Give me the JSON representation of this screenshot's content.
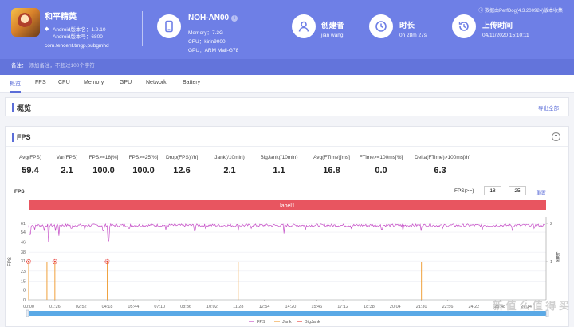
{
  "header": {
    "app_name": "和平精英",
    "version_name": "Android版本名：1.9.10",
    "version_code": "Android版本号：6800",
    "package": "com.tencent.tmgp.pubgmhd",
    "device_name": "NOH-AN00",
    "memory": "Memory：7.3G",
    "cpu": "CPU：kirin9000",
    "gpu": "GPU：ARM Mali-G78",
    "creator_label": "创建者",
    "creator": "jian wang",
    "duration_label": "时长",
    "duration": "0h 28m 27s",
    "upload_label": "上传时间",
    "upload_time": "04/11/2020 15:10:11",
    "version_note": "数据由PerfDog(4.3.200924)版本收集"
  },
  "note": {
    "label": "备注：",
    "placeholder": "添加备注，不超过100个字符"
  },
  "tabs": [
    "概览",
    "FPS",
    "CPU",
    "Memory",
    "GPU",
    "Network",
    "Battery"
  ],
  "overview": {
    "title": "概览",
    "export": "导出全部"
  },
  "fps_card": {
    "title": "FPS",
    "stats": [
      {
        "label": "Avg(FPS)",
        "value": "59.4"
      },
      {
        "label": "Var(FPS)",
        "value": "2.1"
      },
      {
        "label": "FPS>=18[%]",
        "value": "100.0"
      },
      {
        "label": "FPS>=25[%]",
        "value": "100.0"
      },
      {
        "label": "Drop(FPS)[/h]",
        "value": "12.6"
      },
      {
        "label": "Jank(/10min)",
        "value": "2.1"
      },
      {
        "label": "BigJank(/10min)",
        "value": "1.1"
      },
      {
        "label": "Avg(FTime)[ms]",
        "value": "16.8"
      },
      {
        "label": "FTime>=100ms[%]",
        "value": "0.0"
      },
      {
        "label": "Delta(FTime)>100ms[/h]",
        "value": "6.3"
      }
    ],
    "chart_label": "FPS",
    "threshold_label": "FPS(>=)",
    "threshold_1": "18",
    "threshold_2": "25",
    "reset": "重置"
  },
  "colors": {
    "header": "#6e7fe6",
    "accent": "#5b6dd8",
    "fps": "#c44cc6",
    "jank": "#f0a03c",
    "bigjank": "#e8413c",
    "label_band": "#e85560",
    "scrollbar": "#5aa9e6"
  },
  "chart_data": {
    "type": "line",
    "band_label": "label1",
    "ylabel": "FPS",
    "y2label": "Jank",
    "yticks": [
      "61",
      "54",
      "46",
      "38",
      "31",
      "23",
      "15",
      "8",
      "0"
    ],
    "y2ticks": [
      "2",
      "1"
    ],
    "xticks": [
      "00:00",
      "01:26",
      "02:52",
      "04:18",
      "05:44",
      "07:10",
      "08:36",
      "10:02",
      "11:28",
      "12:54",
      "14:20",
      "15:46",
      "17:12",
      "18:38",
      "20:04",
      "21:30",
      "22:56",
      "24:22",
      "25:48",
      "27:14"
    ],
    "ylim": [
      0,
      61
    ],
    "y2lim": [
      0,
      2
    ],
    "fps_baseline": 59.4,
    "fps_dips": [
      {
        "t": "00:04",
        "fps": 52
      },
      {
        "t": "00:20",
        "fps": 56
      },
      {
        "t": "00:52",
        "fps": 55
      },
      {
        "t": "01:05",
        "fps": 46
      },
      {
        "t": "01:28",
        "fps": 55
      },
      {
        "t": "01:40",
        "fps": 51
      },
      {
        "t": "02:20",
        "fps": 57
      },
      {
        "t": "03:05",
        "fps": 56
      },
      {
        "t": "04:05",
        "fps": 55
      },
      {
        "t": "04:22",
        "fps": 47
      },
      {
        "t": "05:30",
        "fps": 57
      },
      {
        "t": "07:30",
        "fps": 56
      },
      {
        "t": "09:05",
        "fps": 55
      },
      {
        "t": "09:40",
        "fps": 57
      },
      {
        "t": "11:28",
        "fps": 55
      },
      {
        "t": "12:10",
        "fps": 57
      },
      {
        "t": "13:58",
        "fps": 53
      },
      {
        "t": "15:10",
        "fps": 56
      },
      {
        "t": "17:40",
        "fps": 57
      },
      {
        "t": "19:20",
        "fps": 56
      },
      {
        "t": "20:30",
        "fps": 55
      },
      {
        "t": "21:28",
        "fps": 55
      },
      {
        "t": "22:40",
        "fps": 57
      },
      {
        "t": "24:50",
        "fps": 56
      },
      {
        "t": "26:30",
        "fps": 55
      },
      {
        "t": "27:40",
        "fps": 57
      }
    ],
    "jank": [
      "00:00",
      "01:00",
      "01:26",
      "04:18",
      "11:28",
      "21:30"
    ],
    "bigjank": [
      "00:00",
      "01:26",
      "04:18"
    ],
    "legend": [
      "FPS",
      "Jank",
      "BigJank"
    ],
    "legend_position": "bottom"
  },
  "watermark": "新 值 么 值 得 买"
}
